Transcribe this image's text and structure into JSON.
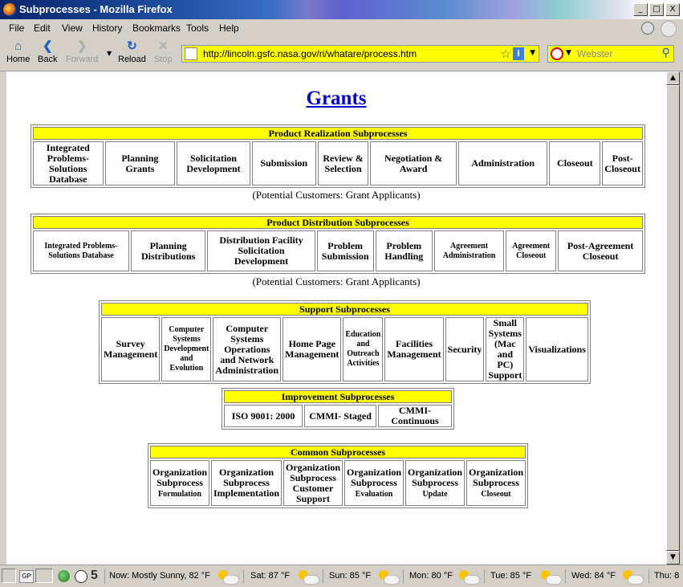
{
  "window": {
    "title": "Subprocesses - Mozilla Firefox",
    "min": "_",
    "max": "□",
    "close": "X"
  },
  "menu": [
    "File",
    "Edit",
    "View",
    "History",
    "Bookmarks",
    "Tools",
    "Help"
  ],
  "nav": {
    "home": "Home",
    "back": "Back",
    "forward": "Forward",
    "reload": "Reload",
    "stop": "Stop"
  },
  "address": {
    "url": "http://lincoln.gsfc.nasa.gov/ri/whatare/process.htm"
  },
  "search": {
    "placeholder": "Webster"
  },
  "page": {
    "title": "Grants",
    "realization": {
      "header": "Product Realization Subprocesses",
      "cells": [
        "Integrated Problems-Solutions Database",
        "Planning Grants",
        "Solicitation Development",
        "Submission",
        "Review & Selection",
        "Negotiation & Award",
        "Administration",
        "Closeout",
        "Post-Closeout"
      ],
      "caption": "(Potential Customers: Grant Applicants)"
    },
    "distribution": {
      "header": "Product Distribution Subprocesses",
      "cells": [
        "Integrated Problems-Solutions Database",
        "Planning Distributions",
        "Distribution Facility Solicitation Development",
        "Problem Submission",
        "Problem Handling",
        "Agreement Administration",
        "Agreement Closeout",
        "Post-Agreement Closeout"
      ],
      "caption": "(Potential Customers: Grant Applicants)"
    },
    "support": {
      "header": "Support Subprocesses",
      "cells": [
        "Survey Management",
        "Computer Systems Development and Evolution",
        "Computer Systems Operations and Network Administration",
        "Home Page Management",
        "Education and Outreach Activities",
        "Facilities Management",
        "Security",
        "Small Systems (Mac and PC) Support",
        "Visualizations"
      ]
    },
    "improvement": {
      "header": "Improvement Subprocesses",
      "cells": [
        "ISO 9001: 2000",
        "CMMI- Staged",
        "CMMI- Continuous"
      ]
    },
    "common": {
      "header": "Common Subprocesses",
      "cells": [
        {
          "main": "Organization Subprocess",
          "sub": "Formulation"
        },
        {
          "main": "Organization Subprocess",
          "sub": "Implementation"
        },
        {
          "main": "Organization Subprocess",
          "sub": "Customer Support"
        },
        {
          "main": "Organization Subprocess",
          "sub": "Evaluation"
        },
        {
          "main": "Organization Subprocess",
          "sub": "Update"
        },
        {
          "main": "Organization Subprocess",
          "sub": "Closeout"
        }
      ]
    }
  },
  "status": {
    "gp": "GP",
    "counter": "5",
    "weather": [
      "Now: Mostly Sunny, 82 °F",
      "Sat: 87 °F",
      "Sun: 85 °F",
      "Mon: 80 °F",
      "Tue: 85 °F",
      "Wed: 84 °F",
      "Thu: 8"
    ]
  }
}
